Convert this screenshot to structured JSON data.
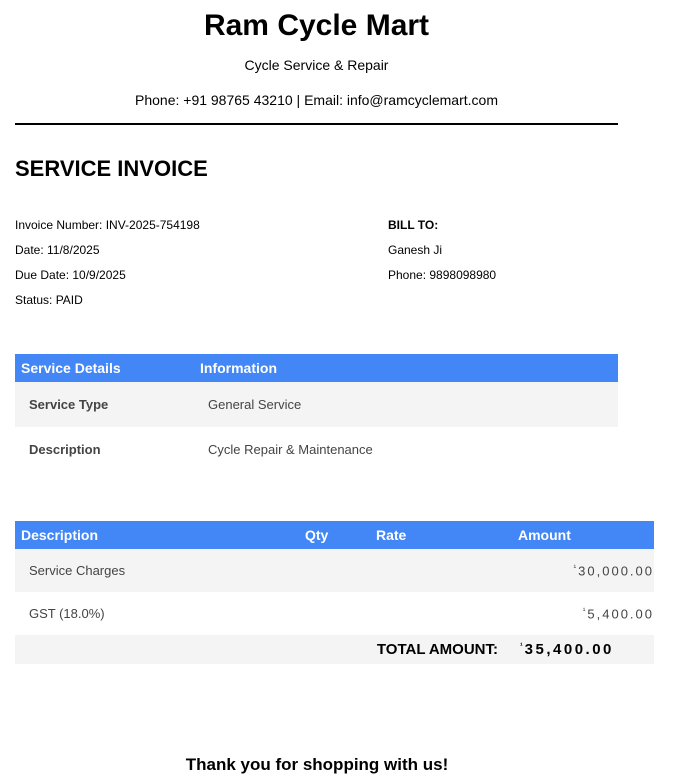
{
  "shop": {
    "name": "Ram Cycle Mart",
    "tagline": "Cycle Service & Repair",
    "contact": "Phone: +91 98765 43210 | Email: info@ramcyclemart.com"
  },
  "invoice": {
    "title": "SERVICE INVOICE",
    "number": "Invoice Number: INV-2025-754198",
    "date": "Date: 11/8/2025",
    "due_date": "Due Date: 10/9/2025",
    "status": "Status: PAID"
  },
  "bill_to": {
    "heading": "BILL TO:",
    "name": "Ganesh Ji",
    "phone": "Phone: 9898098980"
  },
  "service_table": {
    "headers": [
      "Service Details",
      "Information"
    ],
    "rows": [
      {
        "key": "Service Type",
        "value": "General Service"
      },
      {
        "key": "Description",
        "value": "Cycle Repair & Maintenance"
      }
    ]
  },
  "items_table": {
    "headers": [
      "Description",
      "Qty",
      "Rate",
      "Amount"
    ],
    "rows": [
      {
        "description": "Service Charges",
        "amount": "30,000.00"
      },
      {
        "description": "GST (18.0%)",
        "amount": "5,400.00"
      }
    ],
    "currency_symbol": "¹",
    "total_label": "TOTAL AMOUNT:",
    "total_amount": "35,400.00"
  },
  "footer": {
    "thanks": "Thank you for shopping with us!"
  }
}
